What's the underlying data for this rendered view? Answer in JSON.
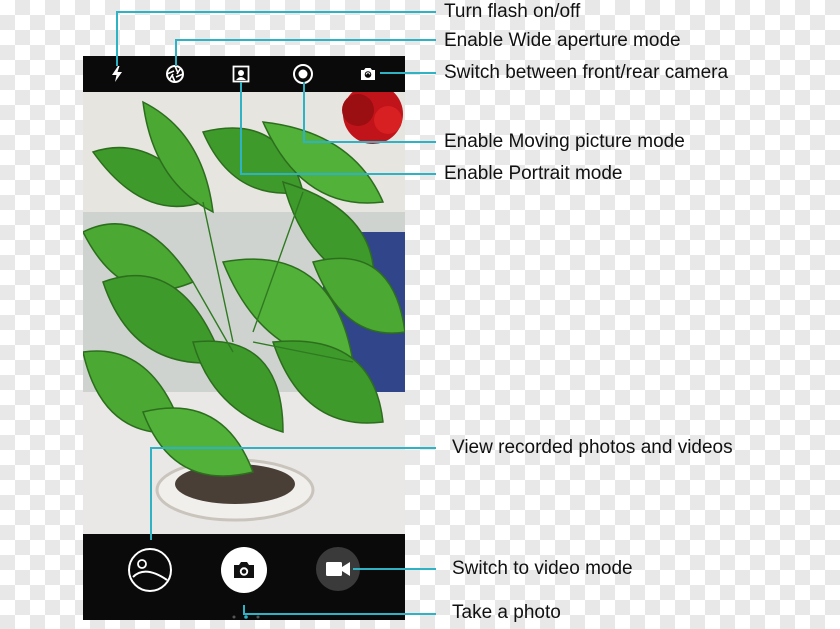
{
  "callouts": {
    "flash": "Turn flash on/off",
    "aperture": "Enable Wide aperture mode",
    "switch_camera": "Switch between front/rear camera",
    "moving_picture": "Enable Moving picture mode",
    "portrait": "Enable Portrait mode",
    "gallery": "View recorded photos and videos",
    "video_mode": "Switch to video mode",
    "take_photo": "Take a photo"
  },
  "icons": {
    "flash": "flash-icon",
    "aperture": "aperture-icon",
    "portrait": "portrait-icon",
    "moving_picture": "moving-picture-icon",
    "switch_camera": "switch-camera-icon",
    "gallery": "gallery-icon",
    "shutter": "shutter-icon",
    "video": "video-icon"
  },
  "colors": {
    "callout_line": "#2fb2c4",
    "bar": "#0a0a0a",
    "leaf": "#3f9a2c",
    "rose": "#c0141a"
  }
}
